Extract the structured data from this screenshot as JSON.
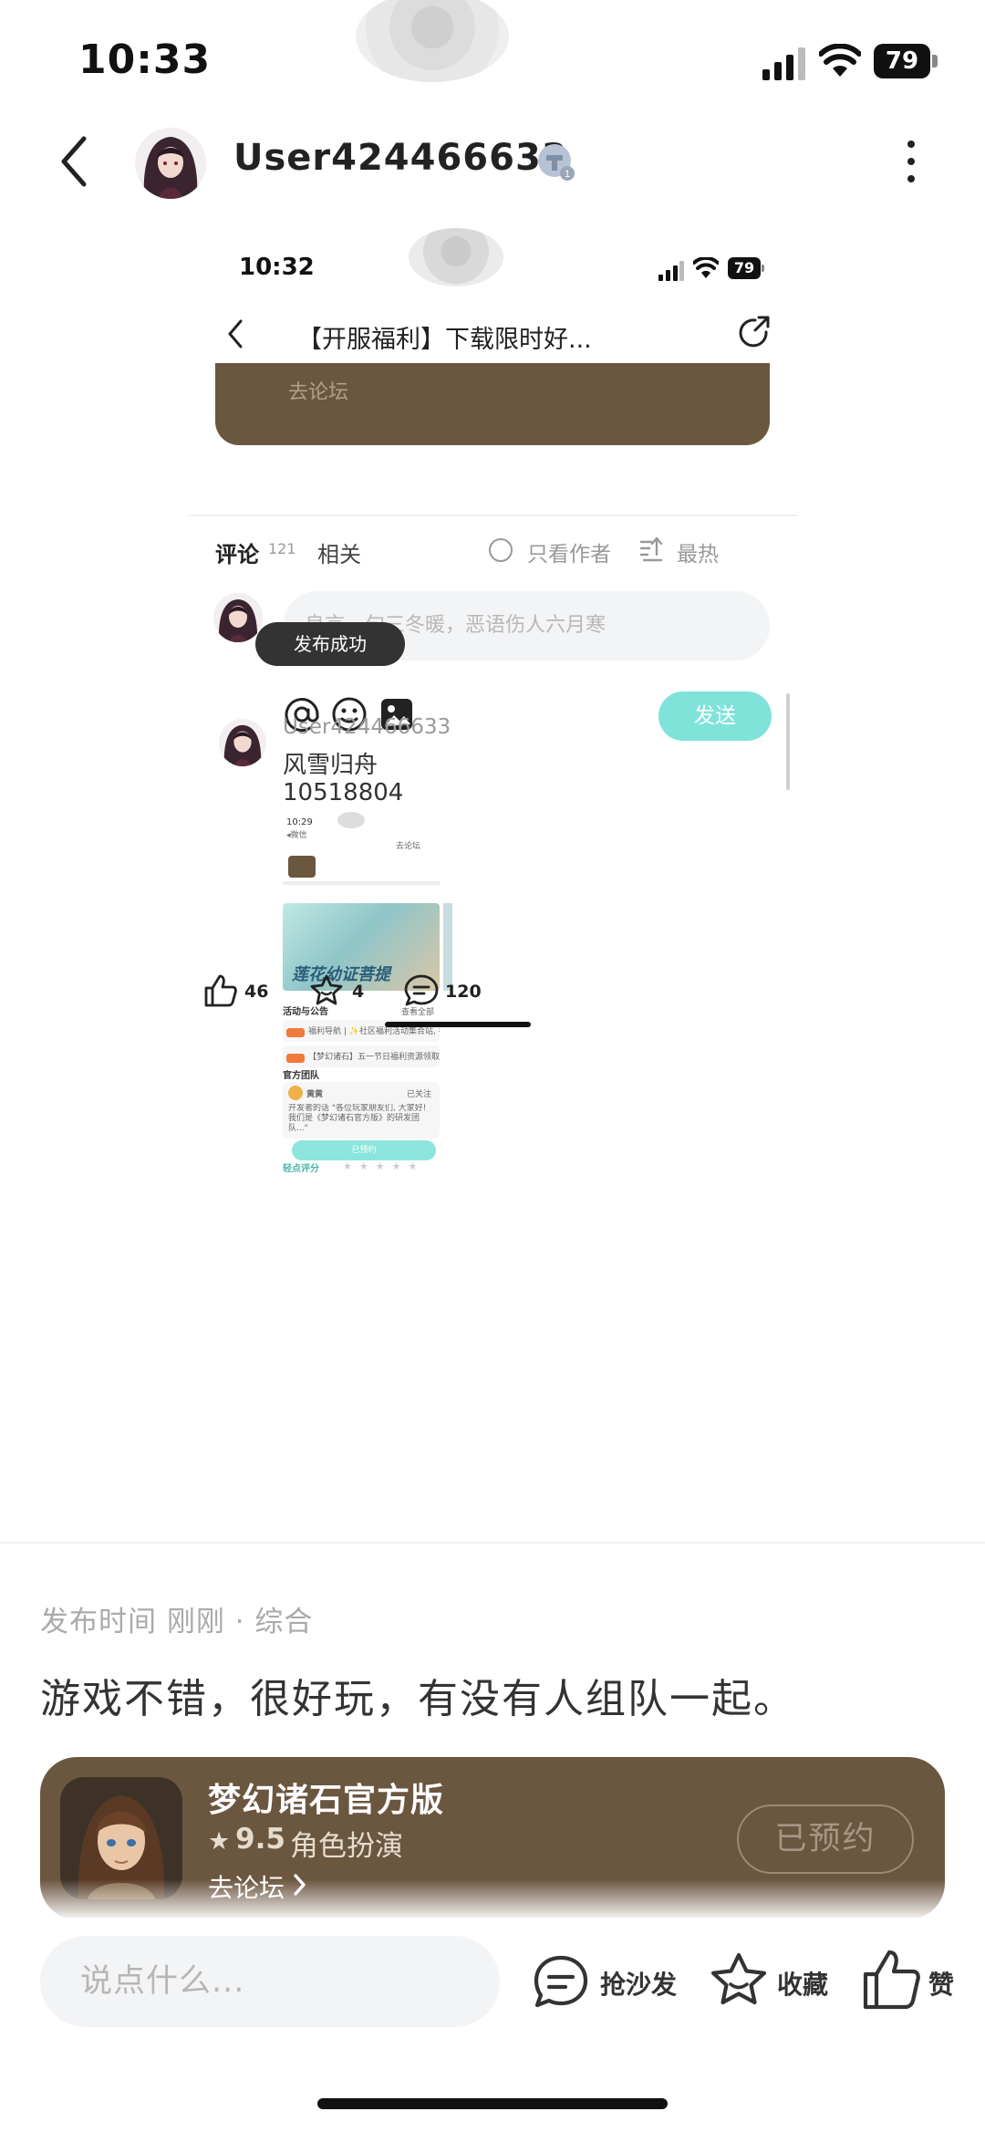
{
  "status_bar": {
    "time": "10:33",
    "battery": "79"
  },
  "header": {
    "username": "User424466633"
  },
  "embedded": {
    "status_time": "10:32",
    "battery": "79",
    "title": "【开服福利】下载限时好...",
    "tabs": {
      "comments": "评论",
      "comment_count": "121",
      "related": "相关"
    },
    "filter": {
      "author_only": "只看作者",
      "hot": "最热"
    },
    "comment_input_placeholder": "良言一句三冬暖，恶语伤人六月寒",
    "send_label": "发送",
    "comment": {
      "user": "User424466633",
      "line1": "风雪归舟",
      "line2": "10518804"
    },
    "toast": "发布成功",
    "mini": {
      "time": "10:29",
      "back_app": "◂微信",
      "forum_btn": "去论坛",
      "banner_title": "莲花幼证菩提",
      "section_activity": "活动与公告",
      "see_all": "查看全部",
      "row1": "福利导航 | ✨社区福利活动集合站, 各种资源...",
      "row2": "【梦幻诸石】五一节日福利资源领取汇总🎁",
      "section_team": "官方团队",
      "card_name": "黄黄",
      "card_text": "开发者的话 \"各位玩家朋友们, 大家好! 我们是《梦幻诸石官方版》的研发团队...\"",
      "followed": "已关注",
      "reserved": "已预约",
      "quick_rate": "轻点评分"
    },
    "actions": {
      "likes": "46",
      "favorites": "4",
      "comments": "120"
    }
  },
  "post": {
    "meta": "发布时间 刚刚 · 综合",
    "text": "游戏不错，很好玩，有没有人组队一起。"
  },
  "game_card": {
    "name": "梦幻诸石官方版",
    "rating": "9.5",
    "genre": "角色扮演",
    "forum_link": "去论坛",
    "reserve_label": "已预约"
  },
  "bottom_bar": {
    "input_placeholder": "说点什么...",
    "sofa_label": "抢沙发",
    "favorite_label": "收藏",
    "like_label": "赞"
  }
}
